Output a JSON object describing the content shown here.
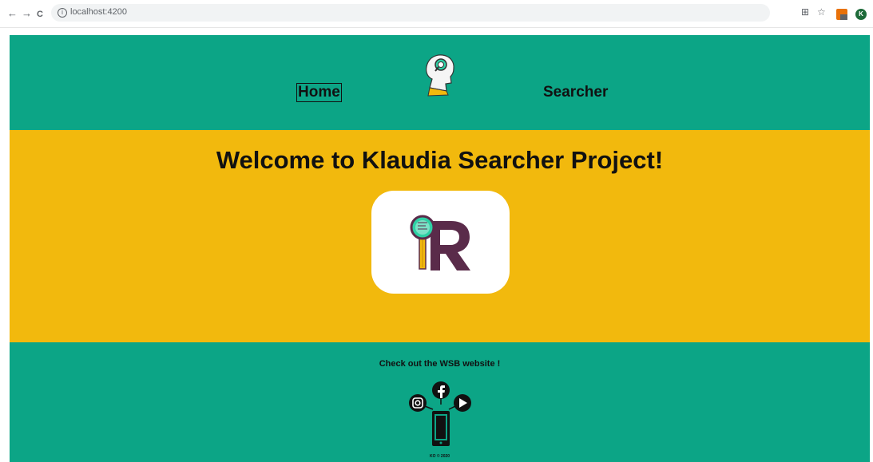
{
  "browser": {
    "url": "localhost:4200",
    "back": "←",
    "forward": "→",
    "reload": "C",
    "info": "i",
    "translate": "⊞",
    "star": "☆",
    "profile_initial": "K"
  },
  "header": {
    "nav_home": "Home",
    "nav_searcher": "Searcher"
  },
  "hero": {
    "title": "Welcome to Klaudia Searcher Project!"
  },
  "footer": {
    "link_text": "Check out the WSB website !",
    "copyright": "KO © 2020"
  },
  "colors": {
    "header_bg": "#0ca586",
    "hero_bg": "#f2b90d",
    "footer_bg": "#0ca586"
  },
  "icons": {
    "header_logo": "head-magnifier-icon",
    "hero_logo": "magnifier-r-logo",
    "social": [
      "instagram-icon",
      "facebook-icon",
      "youtube-icon",
      "smartphone-icon"
    ]
  }
}
